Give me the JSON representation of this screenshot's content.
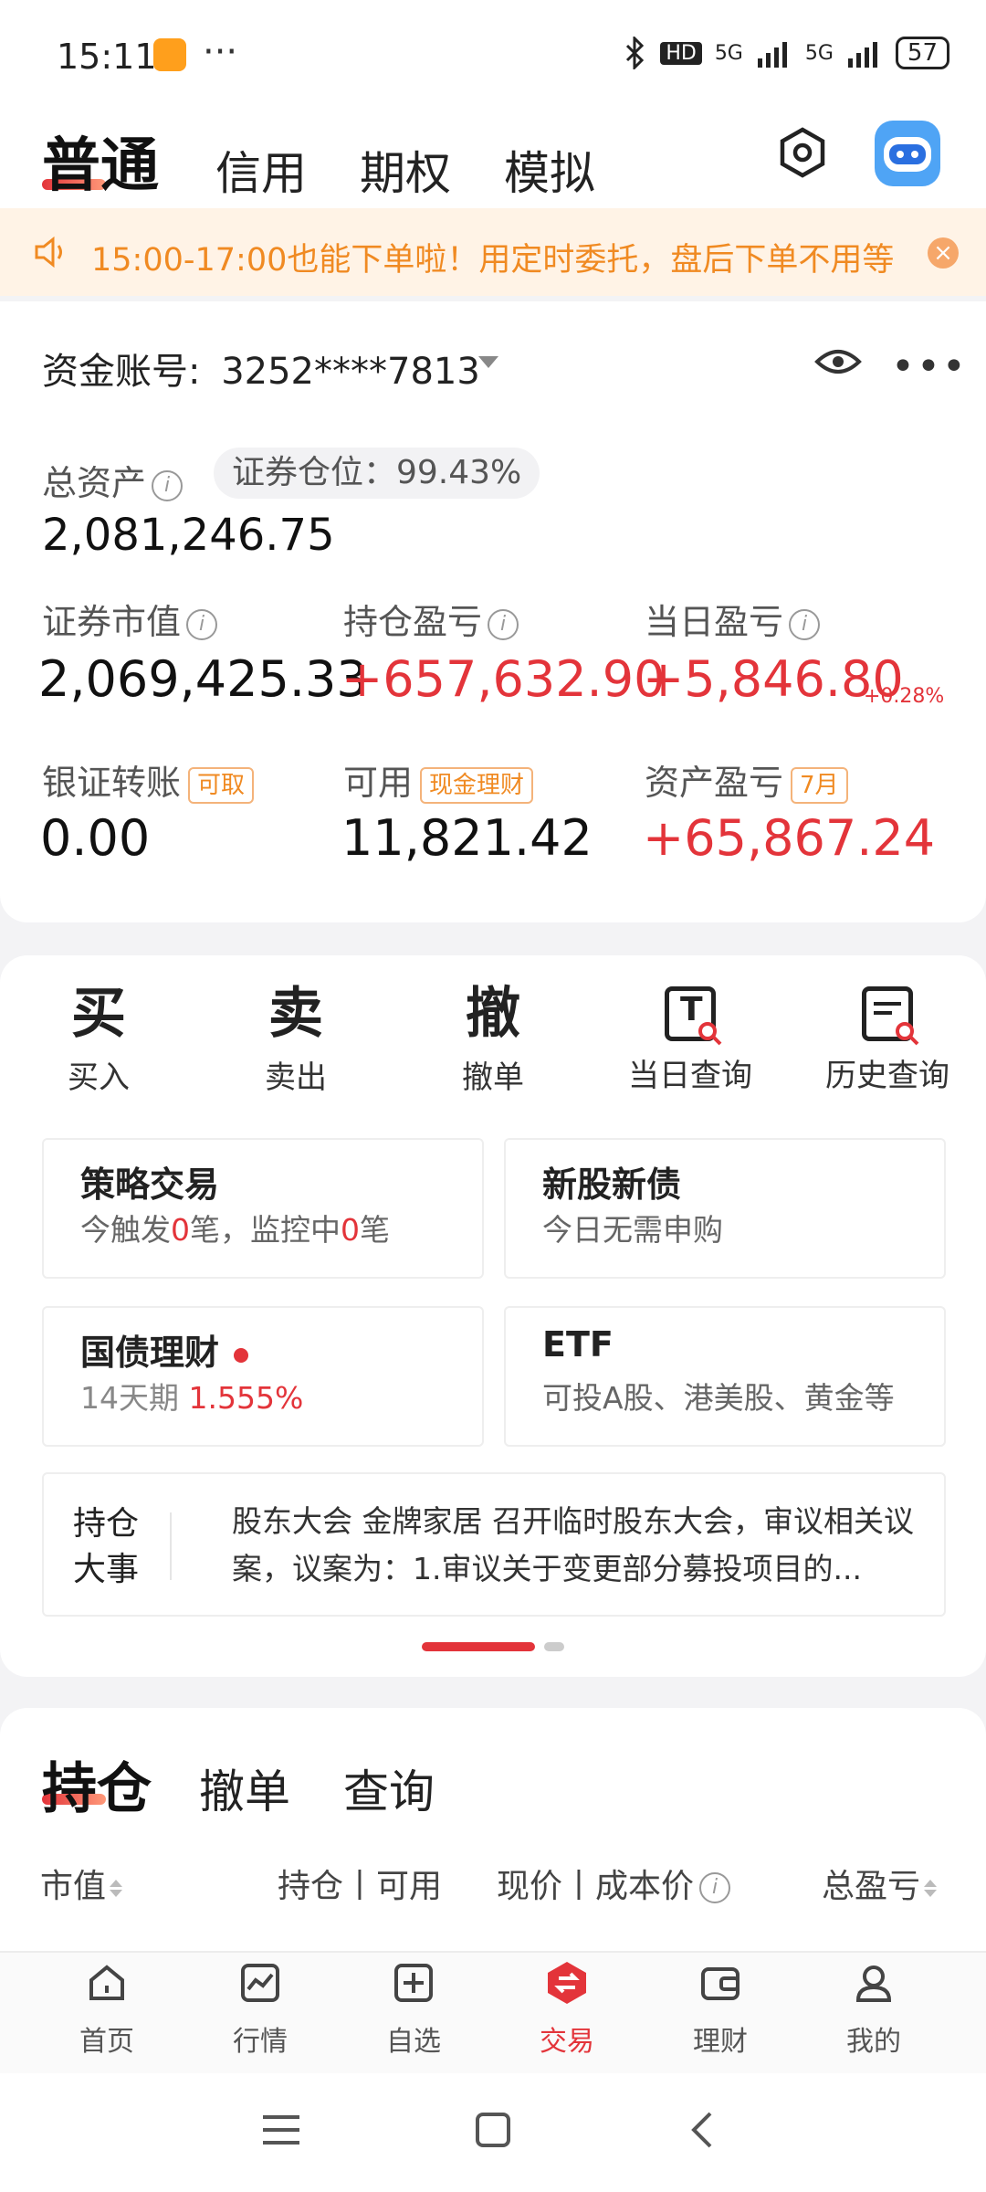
{
  "status_bar": {
    "time": "15:11",
    "more": "···",
    "hd": "HD",
    "signal1": "5G",
    "signal2": "5G",
    "battery": "57"
  },
  "header": {
    "active_tab": "普通",
    "tabs": [
      "信用",
      "期权",
      "模拟"
    ]
  },
  "notice": {
    "text": "15:00-17:00也能下单啦！用定时委托，盘后下单不用等",
    "close": "×"
  },
  "account": {
    "label": "资金账号:",
    "number": "3252****7813",
    "total_assets_label": "总资产",
    "position_label": "证券仓位：99.43%",
    "total_assets": "2,081,246.75",
    "market_value_label": "证券市值",
    "market_value": "2,069,425.33",
    "holding_pl_label": "持仓盈亏",
    "holding_pl": "+657,632.90",
    "daily_pl_label": "当日盈亏",
    "daily_pl": "+5,846.80",
    "daily_pl_pct": "+0.28%",
    "transfer_label": "银证转账",
    "transfer_tag": "可取",
    "transfer_value": "0.00",
    "available_label": "可用",
    "available_tag": "现金理财",
    "available_value": "11,821.42",
    "asset_pl_label": "资产盈亏",
    "asset_pl_tag": "7月",
    "asset_pl_value": "+65,867.24"
  },
  "operations": [
    {
      "glyph": "买",
      "label": "买入"
    },
    {
      "glyph": "卖",
      "label": "卖出"
    },
    {
      "glyph": "撤",
      "label": "撤单"
    },
    {
      "glyph": "T",
      "label": "当日查询"
    },
    {
      "glyph": "",
      "label": "历史查询"
    }
  ],
  "tiles": {
    "strategy": {
      "title": "策略交易",
      "sub_a": "今触发",
      "count_a": "0",
      "sub_b": "笔，监控中",
      "count_b": "0",
      "sub_c": "笔"
    },
    "ipo": {
      "title": "新股新债",
      "sub": "今日无需申购"
    },
    "bond": {
      "title": "国债理财",
      "period": "14天期",
      "rate": "1.555%"
    },
    "etf": {
      "title": "ETF",
      "sub": "可投A股、港美股、黄金等"
    }
  },
  "news": {
    "label_line1": "持仓",
    "label_line2": "大事",
    "text": "股东大会 金牌家居 召开临时股东大会，审议相关议案，议案为：1.审议关于变更部分募投项目的..."
  },
  "holdings": {
    "active_tab": "持仓",
    "tabs": [
      "撤单",
      "查询"
    ],
    "col_market_value": "市值",
    "col_position": "持仓丨可用",
    "col_price": "现价丨成本价",
    "col_total_pl": "总盈亏"
  },
  "bottom_nav": [
    {
      "label": "首页"
    },
    {
      "label": "行情"
    },
    {
      "label": "自选"
    },
    {
      "label": "交易"
    },
    {
      "label": "理财"
    },
    {
      "label": "我的"
    }
  ],
  "colors": {
    "accent_red": "#e3343a",
    "notice_orange": "#f08a22",
    "notice_bg": "#fff3e6"
  }
}
